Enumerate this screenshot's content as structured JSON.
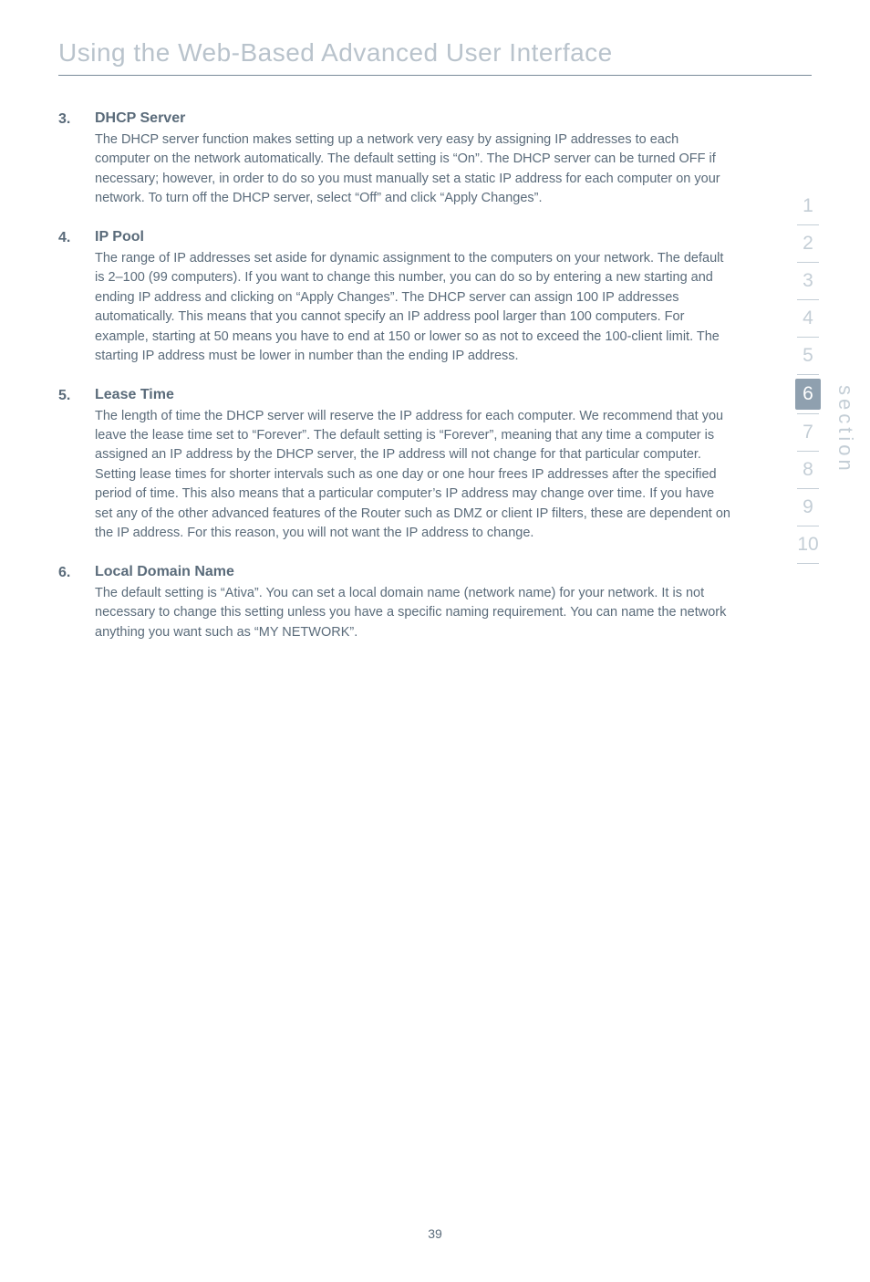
{
  "page": {
    "title": "Using the Web-Based Advanced User Interface",
    "number": "39"
  },
  "items": [
    {
      "num": "3.",
      "heading": "DHCP Server",
      "para": "The DHCP server function makes setting up a network very easy by assigning IP addresses to each computer on the network automatically. The default setting is “On”. The DHCP server can be turned OFF if necessary; however, in order to do so you must manually set a static IP address for each computer on your network. To turn off the DHCP server, select “Off” and click “Apply Changes”."
    },
    {
      "num": "4.",
      "heading": "IP Pool",
      "para": "The range of IP addresses set aside for dynamic assignment to the computers on your network. The default is 2–100 (99 computers). If you want to change this number, you can do so by entering a new starting and ending IP address and clicking on “Apply Changes”. The DHCP server can assign 100 IP addresses automatically. This means that you cannot specify an IP address pool larger than 100 computers. For example, starting at 50 means you have to end at 150 or lower so as not to exceed the 100-client limit. The starting IP address must be lower in number than the ending IP address."
    },
    {
      "num": "5.",
      "heading": "Lease Time",
      "para": "The length of time the DHCP server will reserve the IP address for each computer. We recommend that you leave the lease time set to “Forever”. The default setting is “Forever”, meaning that any time a computer is assigned an IP address by the DHCP server, the IP address will not change for that particular computer. Setting lease times for shorter intervals such as one day or one hour frees IP addresses after the specified period of time. This also means that a particular computer’s IP address may change over time. If you have set any of the other advanced features of the Router such as DMZ or client IP filters, these are dependent on the IP address. For this reason, you will not want the IP address to change."
    },
    {
      "num": "6.",
      "heading": "Local Domain Name",
      "para": "The default setting is “Ativa”. You can set a local domain name (network name) for your network. It is not necessary to change this setting unless you have a specific naming requirement. You can name the network anything you want such as “MY NETWORK”."
    }
  ],
  "sidebar": {
    "label": "section",
    "numbers": [
      "1",
      "2",
      "3",
      "4",
      "5",
      "6",
      "7",
      "8",
      "9",
      "10"
    ],
    "active": "6"
  }
}
